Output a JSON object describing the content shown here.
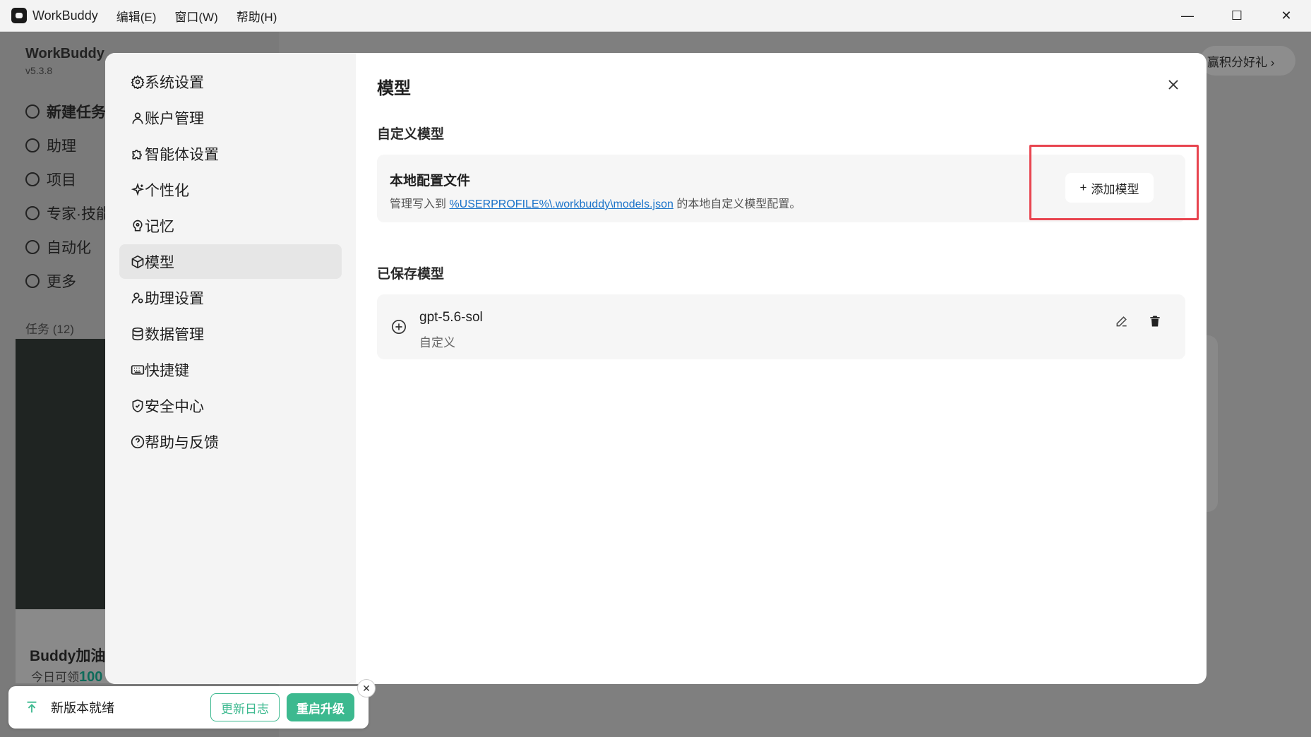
{
  "titlebar": {
    "app_name": "WorkBuddy",
    "menus": [
      "编辑(E)",
      "窗口(W)",
      "帮助(H)"
    ],
    "minimize": "—",
    "maximize": "☐",
    "close": "✕"
  },
  "background": {
    "brand": "WorkBuddy",
    "version": "v5.3.8",
    "nav": [
      "新建任务",
      "助理",
      "项目",
      "专家·技能",
      "自动化",
      "更多"
    ],
    "tasks_label": "任务 (12)",
    "card_title": "Buddy加油站",
    "card_sub": "今日可领",
    "card_amount": "100",
    "promo": "赢积分好礼 ›"
  },
  "settings": {
    "nav": [
      {
        "label": "系统设置",
        "icon": "gear-icon"
      },
      {
        "label": "账户管理",
        "icon": "user-icon"
      },
      {
        "label": "智能体设置",
        "icon": "puzzle-icon"
      },
      {
        "label": "个性化",
        "icon": "sparkle-icon"
      },
      {
        "label": "记忆",
        "icon": "brain-icon"
      },
      {
        "label": "模型",
        "icon": "cube-icon"
      },
      {
        "label": "助理设置",
        "icon": "user-gear-icon"
      },
      {
        "label": "数据管理",
        "icon": "database-icon"
      },
      {
        "label": "快捷键",
        "icon": "keyboard-icon"
      },
      {
        "label": "安全中心",
        "icon": "shield-icon"
      },
      {
        "label": "帮助与反馈",
        "icon": "help-icon"
      }
    ],
    "active_index": 5
  },
  "main": {
    "title": "模型",
    "custom_section": "自定义模型",
    "config": {
      "title": "本地配置文件",
      "desc_prefix": "管理写入到 ",
      "path": "%USERPROFILE%\\.workbuddy\\models.json",
      "desc_suffix": " 的本地自定义模型配置。",
      "add_label": "添加模型"
    },
    "saved_section": "已保存模型",
    "models": [
      {
        "name": "gpt-5.6-sol",
        "tag": "自定义"
      }
    ]
  },
  "toast": {
    "text": "新版本就绪",
    "changelog": "更新日志",
    "restart": "重启升级"
  },
  "colors": {
    "accent_green": "#3cb98f",
    "highlight_red": "#e8444f",
    "link_blue": "#1a73c9"
  }
}
